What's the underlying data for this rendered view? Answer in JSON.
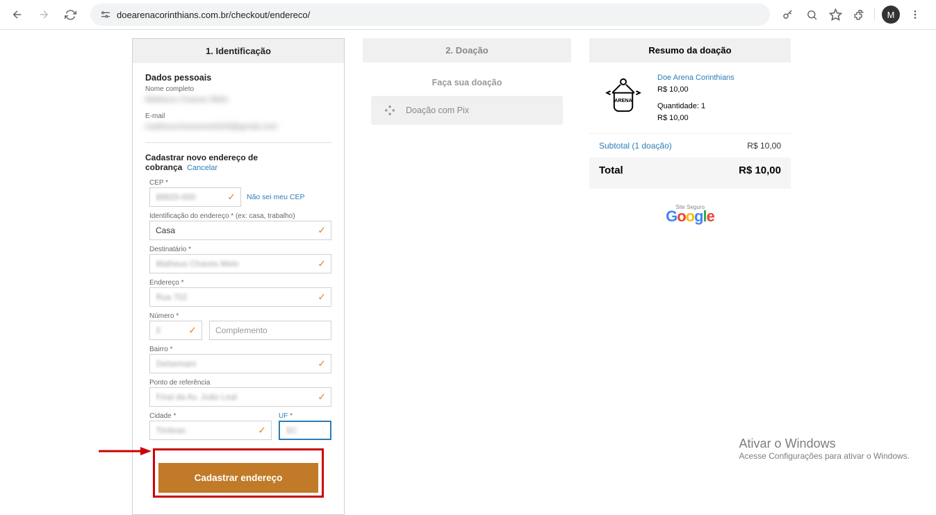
{
  "browser": {
    "url": "doearenacorinthians.com.br/checkout/endereco/",
    "avatar": "M"
  },
  "step1": {
    "title": "1. Identificação",
    "personal": {
      "heading": "Dados pessoais",
      "name_label": "Nome completo",
      "name_value": "Matheus Chaves Melo",
      "email_label": "E-mail",
      "email_value": "matheuschavesmelo04@gmail.com"
    },
    "address": {
      "heading": "Cadastrar novo endereço de cobrança",
      "cancel": "Cancelar",
      "cep_label": "CEP *",
      "cep_value": "88820-000",
      "cep_help": "Não sei meu CEP",
      "ident_label": "Identificação do endereço * (ex: casa, trabalho)",
      "ident_value": "Casa",
      "dest_label": "Destinatário *",
      "dest_value": "Matheus Chaves Melo",
      "addr_label": "Endereço *",
      "addr_value": "Rua 702",
      "num_label": "Número *",
      "num_value": "0",
      "compl_placeholder": "Complemento",
      "bairro_label": "Bairro *",
      "bairro_value": "Getsemani",
      "ref_label": "Ponto de referência",
      "ref_value": "Final da Av. João Leal",
      "city_label": "Cidade *",
      "city_value": "Timbras",
      "uf_label": "UF *",
      "uf_value": "SC",
      "submit": "Cadastrar endereço"
    }
  },
  "step2": {
    "title": "2. Doação",
    "subtitle": "Faça sua doação",
    "pix": "Doação com Pix"
  },
  "summary": {
    "title": "Resumo da doação",
    "product_name": "Doe Arena Corinthians",
    "product_price": "R$ 10,00",
    "qty_label": "Quantidade: 1",
    "qty_price": "R$ 10,00",
    "subtotal_label": "Subtotal (1 doação)",
    "subtotal_value": "R$ 10,00",
    "total_label": "Total",
    "total_value": "R$ 10,00",
    "safe_label": "Site Seguro"
  },
  "watermark": {
    "line1": "Ativar o Windows",
    "line2": "Acesse Configurações para ativar o Windows."
  }
}
